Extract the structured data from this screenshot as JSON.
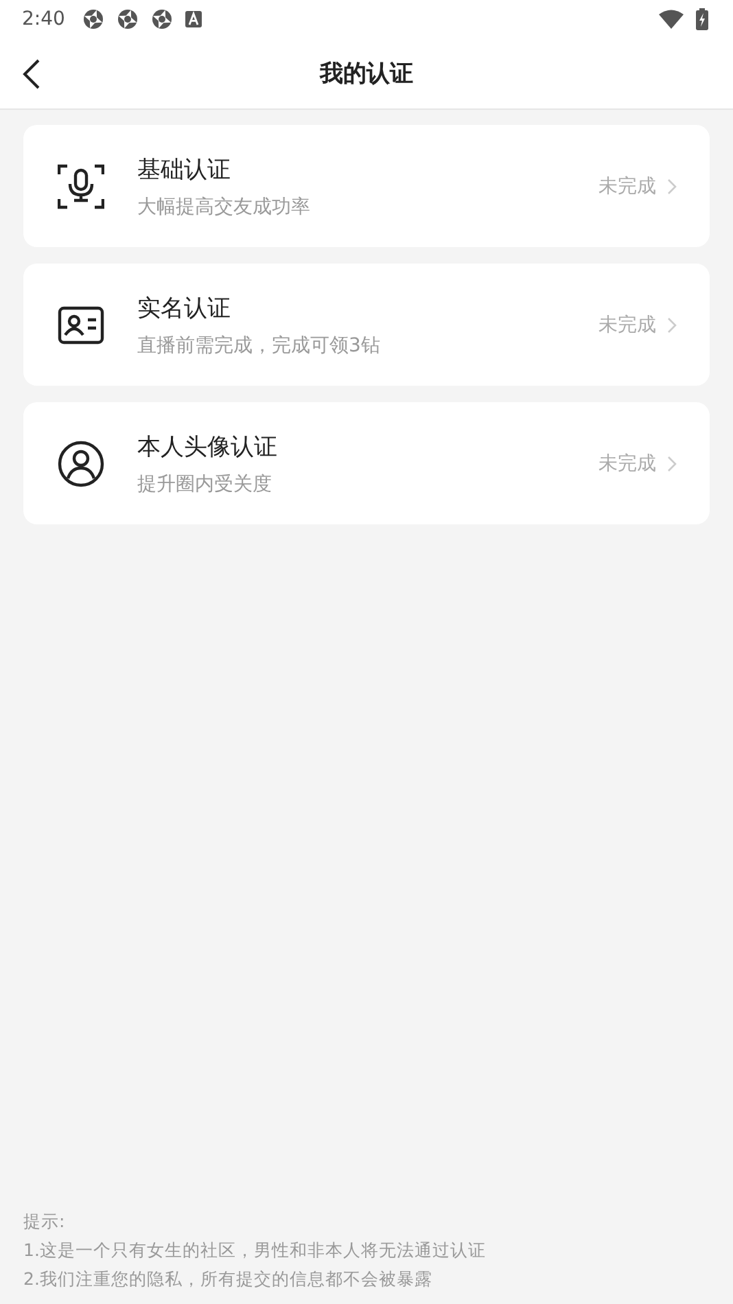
{
  "status_bar": {
    "time": "2:40"
  },
  "header": {
    "title": "我的认证"
  },
  "items": [
    {
      "kind": "voice",
      "title": "基础认证",
      "subtitle": "大幅提高交友成功率",
      "status": "未完成"
    },
    {
      "kind": "id_card",
      "title": "实名认证",
      "subtitle": "直播前需完成，完成可领3钻",
      "status": "未完成"
    },
    {
      "kind": "avatar",
      "title": "本人头像认证",
      "subtitle": "提升圈内受关度",
      "status": "未完成"
    }
  ],
  "tips": {
    "heading": "提示:",
    "lines": [
      "1.这是一个只有女生的社区，男性和非本人将无法通过认证",
      "2.我们注重您的隐私，所有提交的信息都不会被暴露"
    ]
  }
}
